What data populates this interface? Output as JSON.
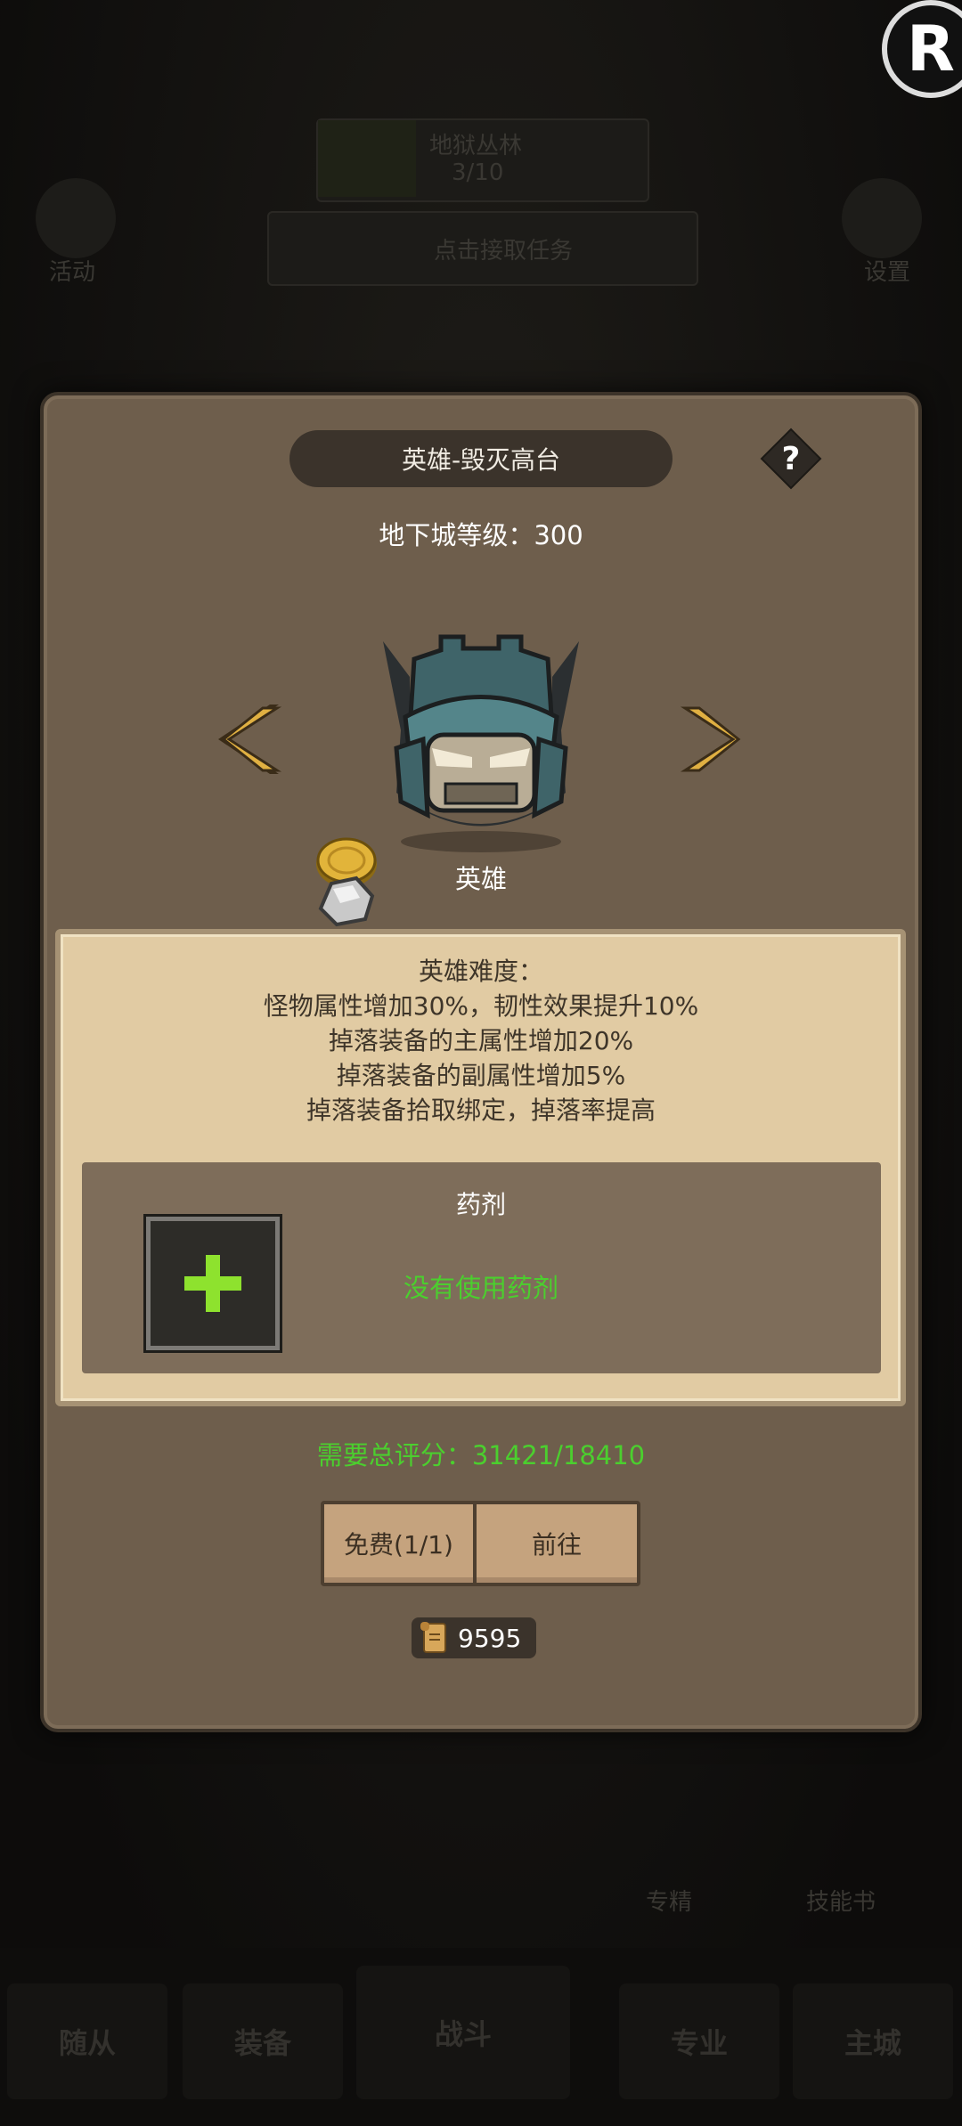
{
  "background": {
    "stage_name": "地狱丛林",
    "stage_progress": "3/10",
    "activity_label": "活动",
    "quest_prompt": "点击接取任务",
    "settings_label": "设置",
    "feature_1": "专精",
    "feature_2": "技能书",
    "nav": [
      "随从",
      "装备",
      "战斗",
      "专业",
      "主城"
    ]
  },
  "dialog": {
    "title": "英雄-毁灭高台",
    "help_symbol": "?",
    "dungeon_level": "地下城等级：300",
    "boss_label": "英雄",
    "difficulty_lines": [
      "英雄难度：",
      "怪物属性增加30%，韧性效果提升10%",
      "掉落装备的主属性增加20%",
      "掉落装备的副属性增加5%",
      "掉落装备拾取绑定，掉落率提高"
    ],
    "potion_title": "药剂",
    "potion_status": "没有使用药剂",
    "score": "需要总评分：31421/18410",
    "free_button": "免费(1/1)",
    "go_button": "前往",
    "currency_value": "9595"
  },
  "colors": {
    "panel": "#6e5e4c",
    "parchment": "#e1cba3",
    "green_text": "#4bcf2e",
    "potion_plus": "#8ee22e"
  },
  "icons": [
    "help-icon",
    "left-arrow-icon",
    "right-arrow-icon",
    "boss-helmet-icon",
    "coin-icon",
    "stone-icon",
    "plus-icon",
    "scroll-icon"
  ]
}
